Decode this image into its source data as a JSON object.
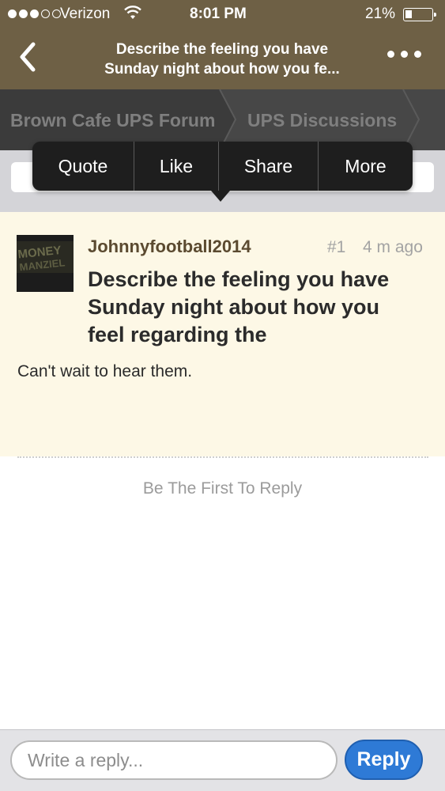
{
  "status_bar": {
    "carrier": "Verizon",
    "time": "8:01 PM",
    "battery_percent": "21%",
    "battery_level": 0.21,
    "signal_bars_filled": 3,
    "signal_bars_total": 5
  },
  "nav": {
    "title_line1": "Describe the feeling you have",
    "title_line2": "Sunday night about how you fe..."
  },
  "breadcrumb": {
    "items": [
      "Brown Cafe UPS Forum",
      "UPS Discussions"
    ]
  },
  "popup_menu": {
    "items": [
      "Quote",
      "Like",
      "Share",
      "More"
    ]
  },
  "post": {
    "username": "Johnnyfootball2014",
    "number": "#1",
    "time_ago": "4 m ago",
    "title": "Describe the feeling you have Sunday night about how you feel regarding the",
    "body": "Can't wait to hear them.",
    "avatar_text": "MONEY MANZIEL"
  },
  "replies": {
    "empty_message": "Be The First To Reply"
  },
  "reply_bar": {
    "placeholder": "Write a reply...",
    "button_label": "Reply"
  },
  "colors": {
    "header_brown": "#6e6045",
    "post_background": "#fdf8e6",
    "reply_blue": "#2e7ad6"
  }
}
